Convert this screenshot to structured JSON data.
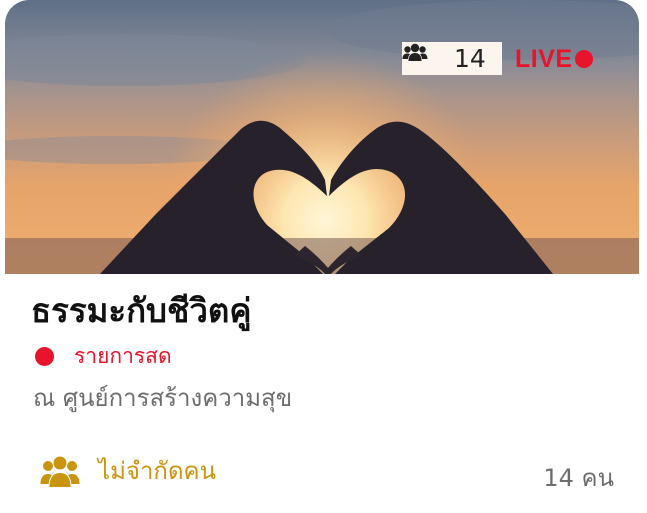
{
  "hero": {
    "image": "heart-hands-sunset-photo",
    "viewer_count": "14",
    "live_label": "LIVE",
    "viewer_icon": "people-icon"
  },
  "event": {
    "title": "ธรรมะกับชีวิตคู่",
    "status_label": "รายการสด",
    "venue": "ณ ศูนย์การสร้างความสุข",
    "capacity_label": "ไม่จำกัดคน",
    "attendee_count": "14 คน",
    "capacity_icon": "people-icon"
  },
  "colors": {
    "live_red": "#e8142c",
    "capacity_gold": "#c99410",
    "muted_gray": "#6d6d6d"
  }
}
